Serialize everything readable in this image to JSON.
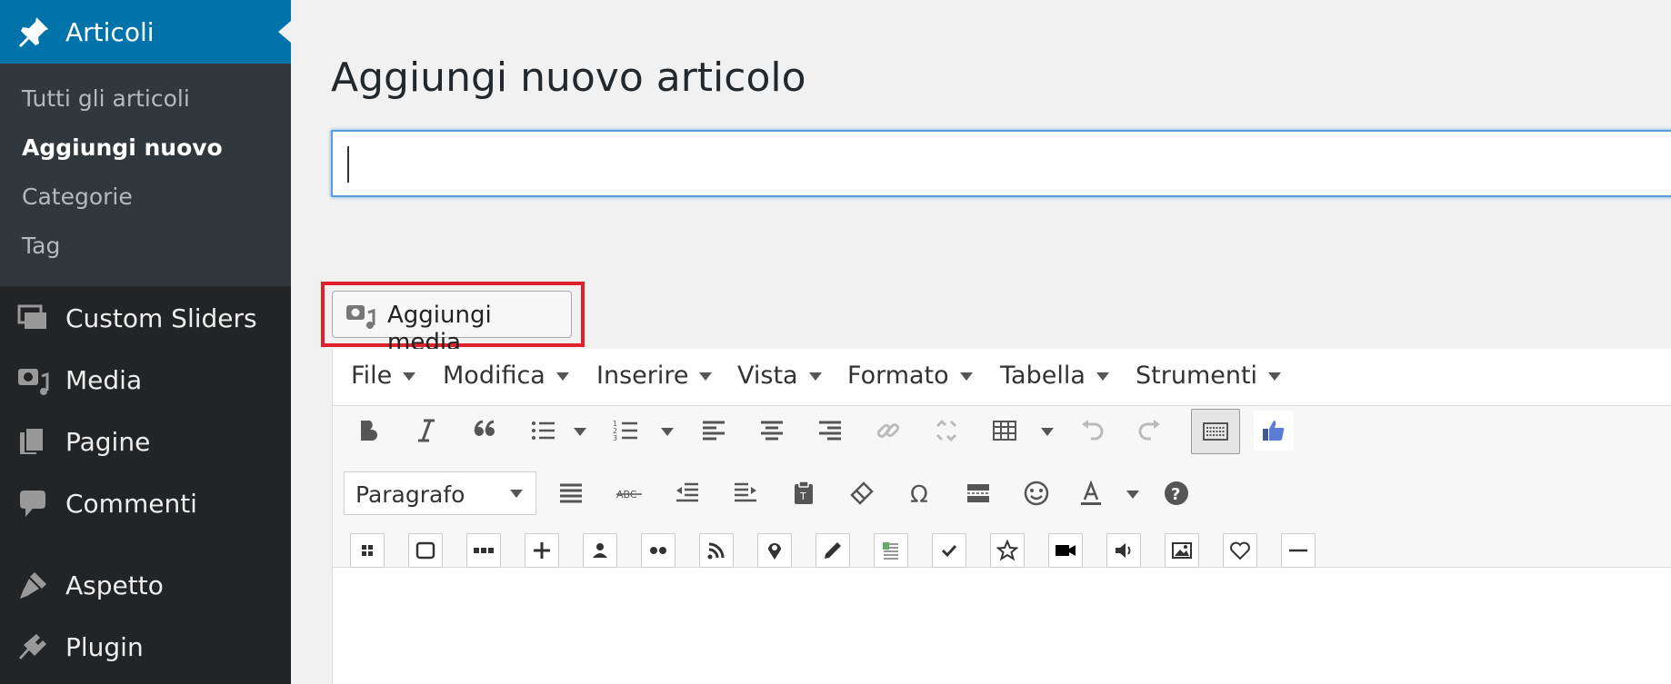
{
  "sidebar": {
    "current": {
      "label": "Articoli",
      "icon": "pushpin-icon"
    },
    "submenu": [
      {
        "label": "Tutti gli articoli",
        "active": false
      },
      {
        "label": "Aggiungi nuovo",
        "active": true
      },
      {
        "label": "Categorie",
        "active": false
      },
      {
        "label": "Tag",
        "active": false
      }
    ],
    "items": [
      {
        "label": "Custom Sliders",
        "icon": "slides-icon"
      },
      {
        "label": "Media",
        "icon": "media-icon"
      },
      {
        "label": "Pagine",
        "icon": "pages-icon"
      },
      {
        "label": "Commenti",
        "icon": "comment-icon"
      },
      {
        "label": "Aspetto",
        "icon": "brush-icon"
      },
      {
        "label": "Plugin",
        "icon": "plug-icon"
      }
    ]
  },
  "main": {
    "title": "Aggiungi nuovo articolo",
    "title_input_value": "",
    "add_media_label": "Aggiungi media"
  },
  "editor": {
    "menubar": [
      "File",
      "Modifica",
      "Inserire",
      "Vista",
      "Formato",
      "Tabella",
      "Strumenti"
    ],
    "format_select": "Paragrafo",
    "colors": {
      "accent": "#0073aa",
      "highlight": "#e0202a",
      "sidebar": "#222426",
      "submenu": "#32373c"
    }
  }
}
